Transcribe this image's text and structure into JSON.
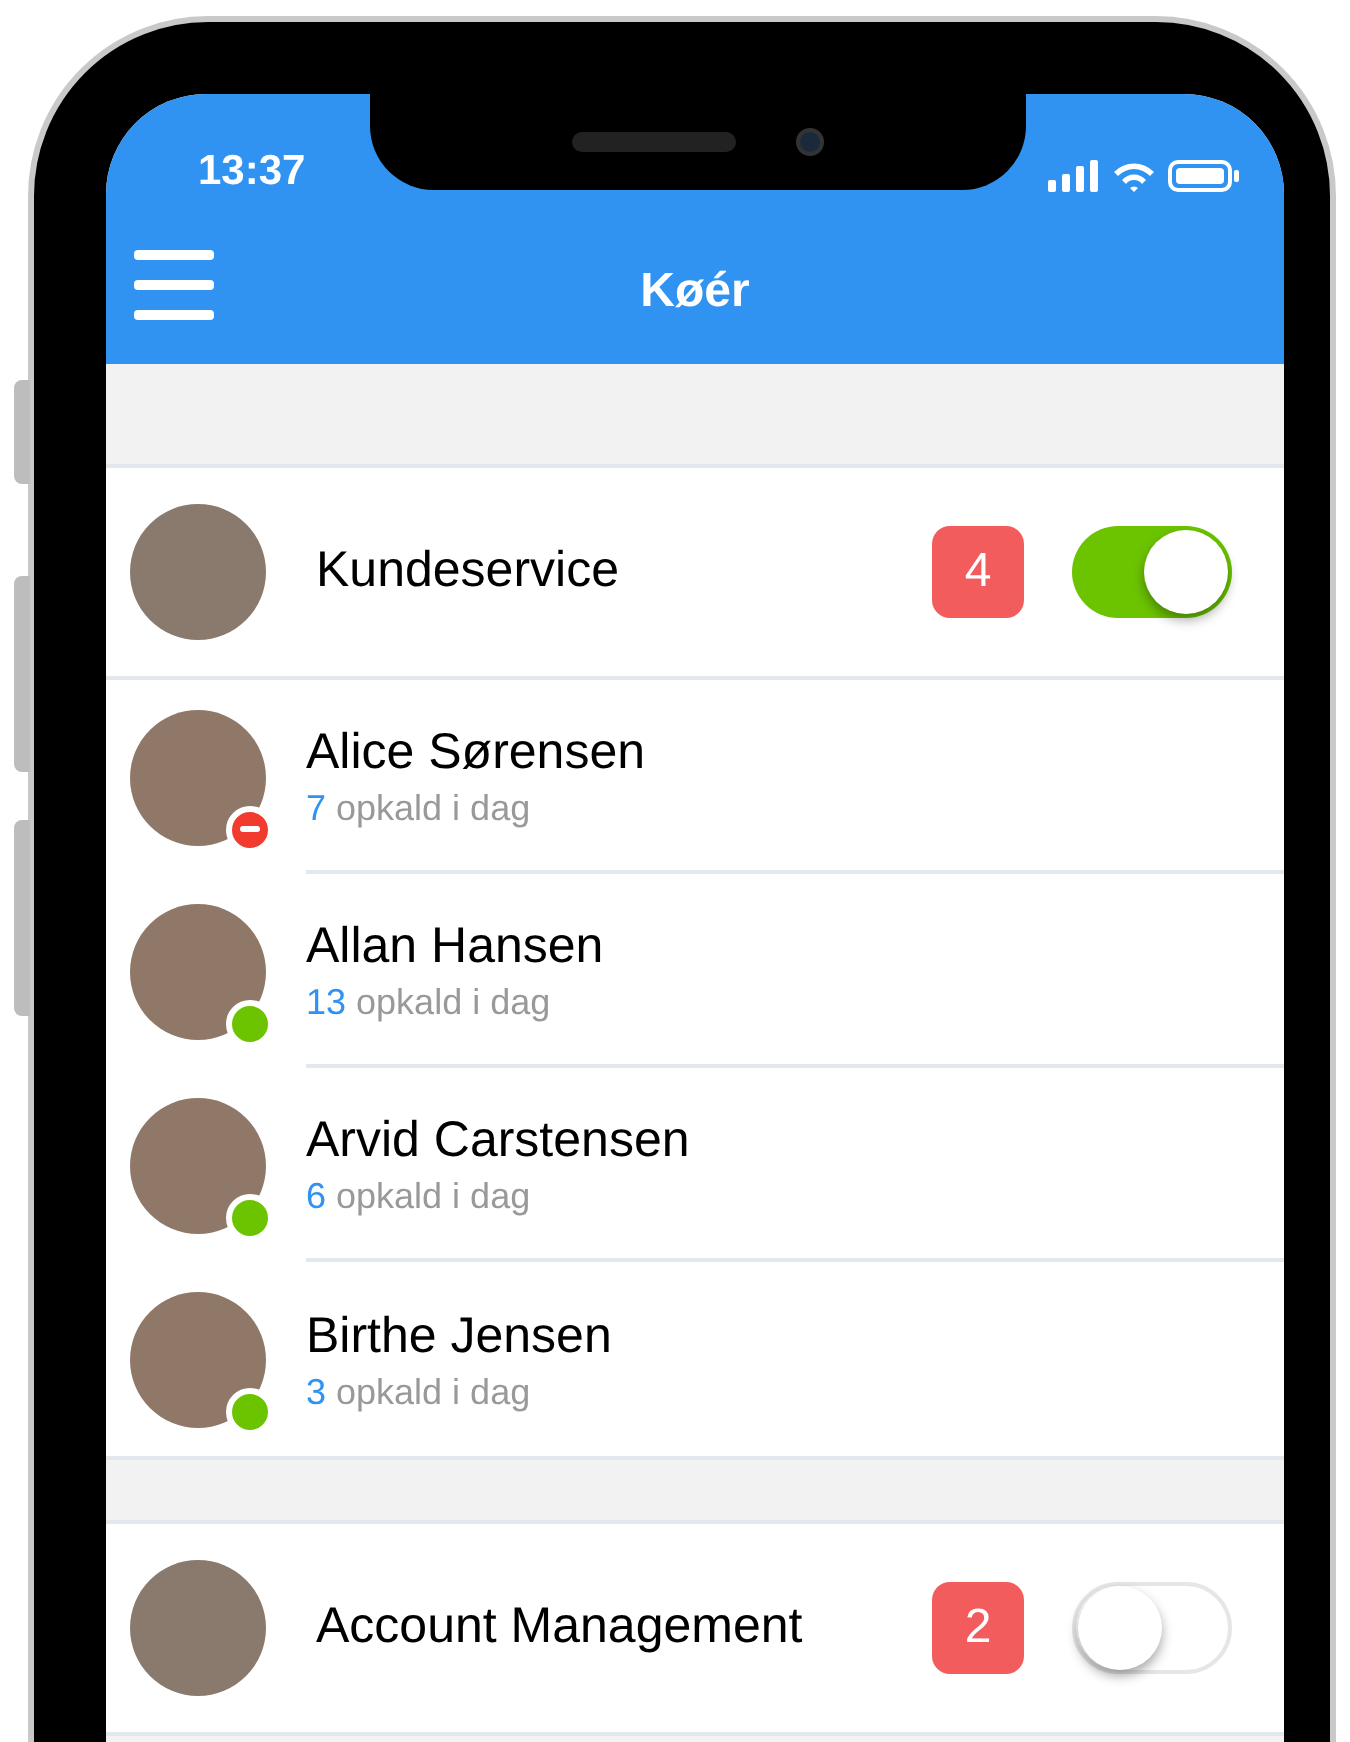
{
  "status_bar": {
    "time": "13:37"
  },
  "nav": {
    "title": "Køér"
  },
  "groups": [
    {
      "name": "Kundeservice",
      "badge": "4",
      "on": true,
      "members": [
        {
          "name": "Alice Sørensen",
          "calls": "7",
          "calls_label": "opkald i dag",
          "busy": true
        },
        {
          "name": "Allan Hansen",
          "calls": "13",
          "calls_label": "opkald i dag",
          "busy": false
        },
        {
          "name": "Arvid Carstensen",
          "calls": "6",
          "calls_label": "opkald i dag",
          "busy": false
        },
        {
          "name": "Birthe Jensen",
          "calls": "3",
          "calls_label": "opkald i dag",
          "busy": false
        }
      ]
    },
    {
      "name": "Account Management",
      "badge": "2",
      "on": false
    }
  ]
}
